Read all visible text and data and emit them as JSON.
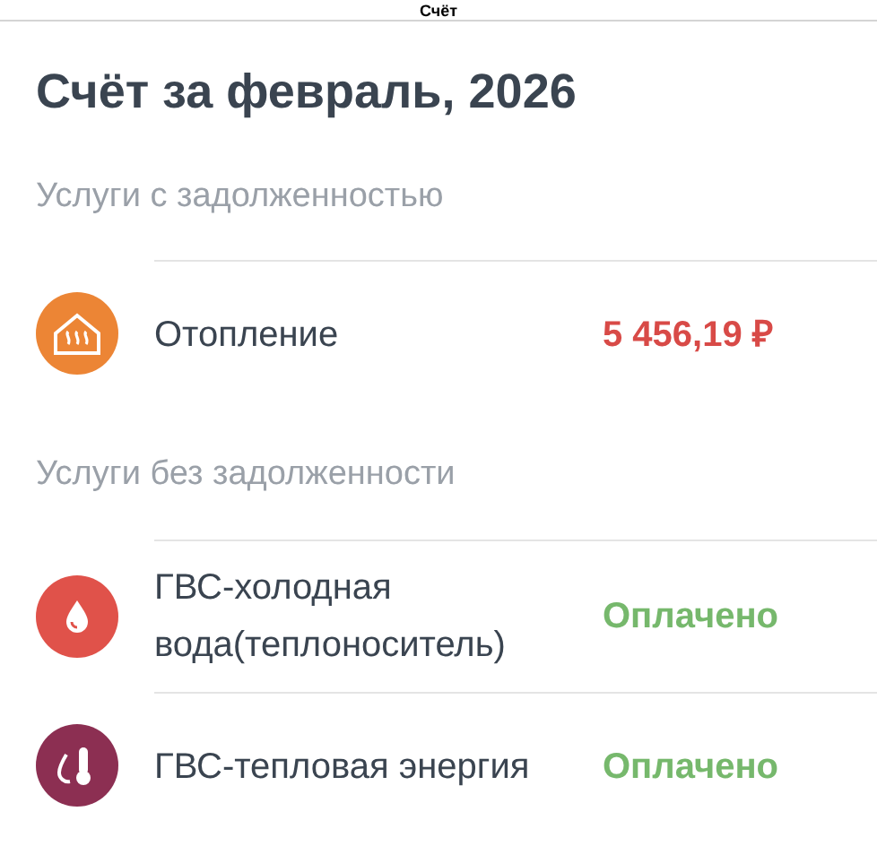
{
  "nav_bar": {
    "title": "Счёт"
  },
  "heading": "Счёт за февраль, 2026",
  "sections": [
    {
      "title": "Услуги с задолженностью",
      "kind": "debt",
      "items": [
        {
          "kind": "heating",
          "color": "#ec8535",
          "name": "Отопление",
          "status": "5 456,19 ₽"
        }
      ]
    },
    {
      "title": "Услуги без задолженности",
      "kind": "paid",
      "items": [
        {
          "kind": "drop",
          "color": "#e0524a",
          "name": "ГВС-холодная вода(теплоноситель)",
          "status": "Оплачено"
        },
        {
          "kind": "thermo",
          "color": "#8c2f52",
          "name": "ГВС-тепловая энергия",
          "status": "Оплачено"
        }
      ]
    }
  ]
}
